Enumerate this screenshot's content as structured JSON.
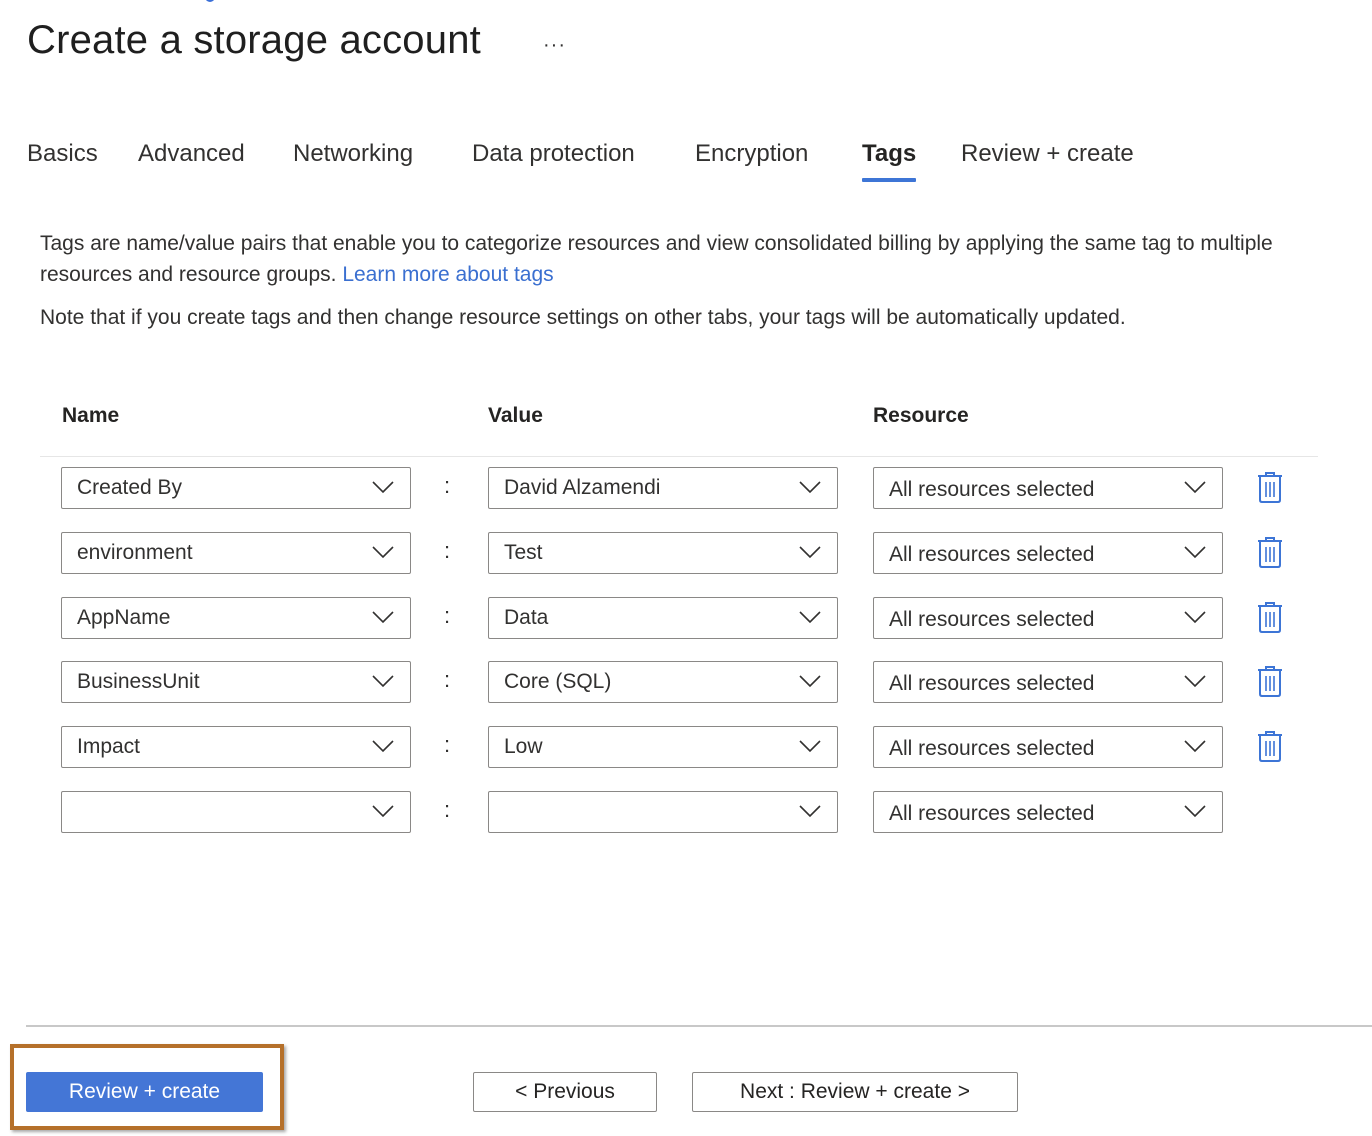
{
  "page": {
    "title": "Create a storage account",
    "more_label": "···"
  },
  "tabs": [
    {
      "label": "Basics",
      "active": false
    },
    {
      "label": "Advanced",
      "active": false
    },
    {
      "label": "Networking",
      "active": false
    },
    {
      "label": "Data protection",
      "active": false
    },
    {
      "label": "Encryption",
      "active": false
    },
    {
      "label": "Tags",
      "active": true
    },
    {
      "label": "Review + create",
      "active": false
    }
  ],
  "description": {
    "text": "Tags are name/value pairs that enable you to categorize resources and view consolidated billing by applying the same tag to multiple resources and resource groups. ",
    "link_label": "Learn more about tags",
    "note": "Note that if you create tags and then change resource settings on other tabs, your tags will be automatically updated."
  },
  "table": {
    "columns": {
      "name": "Name",
      "value": "Value",
      "resource": "Resource"
    },
    "separator": ":",
    "rows": [
      {
        "name": "Created By",
        "value": "David Alzamendi",
        "resource": "All resources selected",
        "deletable": true
      },
      {
        "name": "environment",
        "value": "Test",
        "resource": "All resources selected",
        "deletable": true
      },
      {
        "name": "AppName",
        "value": "Data",
        "resource": "All resources selected",
        "deletable": true
      },
      {
        "name": "BusinessUnit",
        "value": "Core (SQL)",
        "resource": "All resources selected",
        "deletable": true
      },
      {
        "name": "Impact",
        "value": "Low",
        "resource": "All resources selected",
        "deletable": true
      },
      {
        "name": "",
        "value": "",
        "resource": "All resources selected",
        "deletable": false
      }
    ]
  },
  "icons": {
    "dropdown": "chevron-down-icon",
    "delete": "trash-icon"
  },
  "colors": {
    "accent": "#3d75d6",
    "primary_button": "#4476d6",
    "link": "#3a6fd0",
    "highlight_border": "#b5702a"
  },
  "footer": {
    "review_create_label": "Review + create",
    "previous_label": "< Previous",
    "next_label": "Next : Review + create >"
  }
}
